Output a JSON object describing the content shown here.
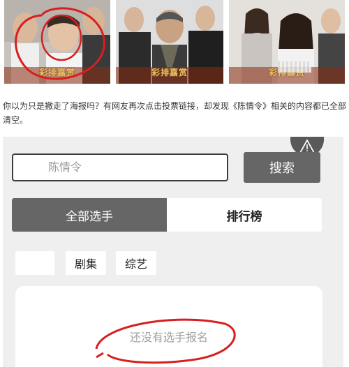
{
  "posters": [
    {
      "brand": "彩排嘉赏"
    },
    {
      "brand": "彩排嘉赏"
    },
    {
      "brand": "彩排嘉赏"
    }
  ],
  "article": {
    "text": "你以为只是撤走了海报吗？有网友再次点击投票链接，却发现《陈情令》相关的内容都已全部清空。"
  },
  "app": {
    "warning_icon": "warning-icon",
    "search": {
      "value": "陈情令",
      "button": "搜索"
    },
    "tabs": [
      {
        "label": "全部选手"
      },
      {
        "label": "排行榜"
      }
    ],
    "filters": [
      {
        "label": ""
      },
      {
        "label": "剧集"
      },
      {
        "label": "综艺"
      }
    ],
    "empty_message": "还没有选手报名"
  },
  "colors": {
    "annotation": "#d81e1e",
    "button": "#666666",
    "brand": "#e8c46a"
  }
}
